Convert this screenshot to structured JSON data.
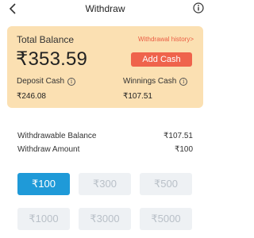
{
  "header": {
    "title": "Withdraw",
    "back_icon": "chevron-left-icon",
    "info_icon": "info-icon"
  },
  "balance_card": {
    "total_label": "Total Balance",
    "total_amount": "₹353.59",
    "history_link": "Withdrawal history>",
    "add_cash_label": "Add Cash",
    "deposit_label": "Deposit Cash",
    "deposit_amount": "₹246.08",
    "winnings_label": "Winnings Cash",
    "winnings_amount": "₹107.51",
    "card_color": "#fbe0b2",
    "accent_color": "#ef634c"
  },
  "summary": {
    "withdrawable_label": "Withdrawable Balance",
    "withdrawable_value": "₹107.51",
    "withdraw_amount_label": "Withdraw Amount",
    "withdraw_amount_value": "₹100"
  },
  "amount_options": [
    {
      "label": "₹100",
      "selected": true
    },
    {
      "label": "₹300",
      "selected": false
    },
    {
      "label": "₹500",
      "selected": false
    },
    {
      "label": "₹1000",
      "selected": false
    },
    {
      "label": "₹3000",
      "selected": false
    },
    {
      "label": "₹5000",
      "selected": false
    }
  ],
  "selected_color": "#1f9ad8"
}
